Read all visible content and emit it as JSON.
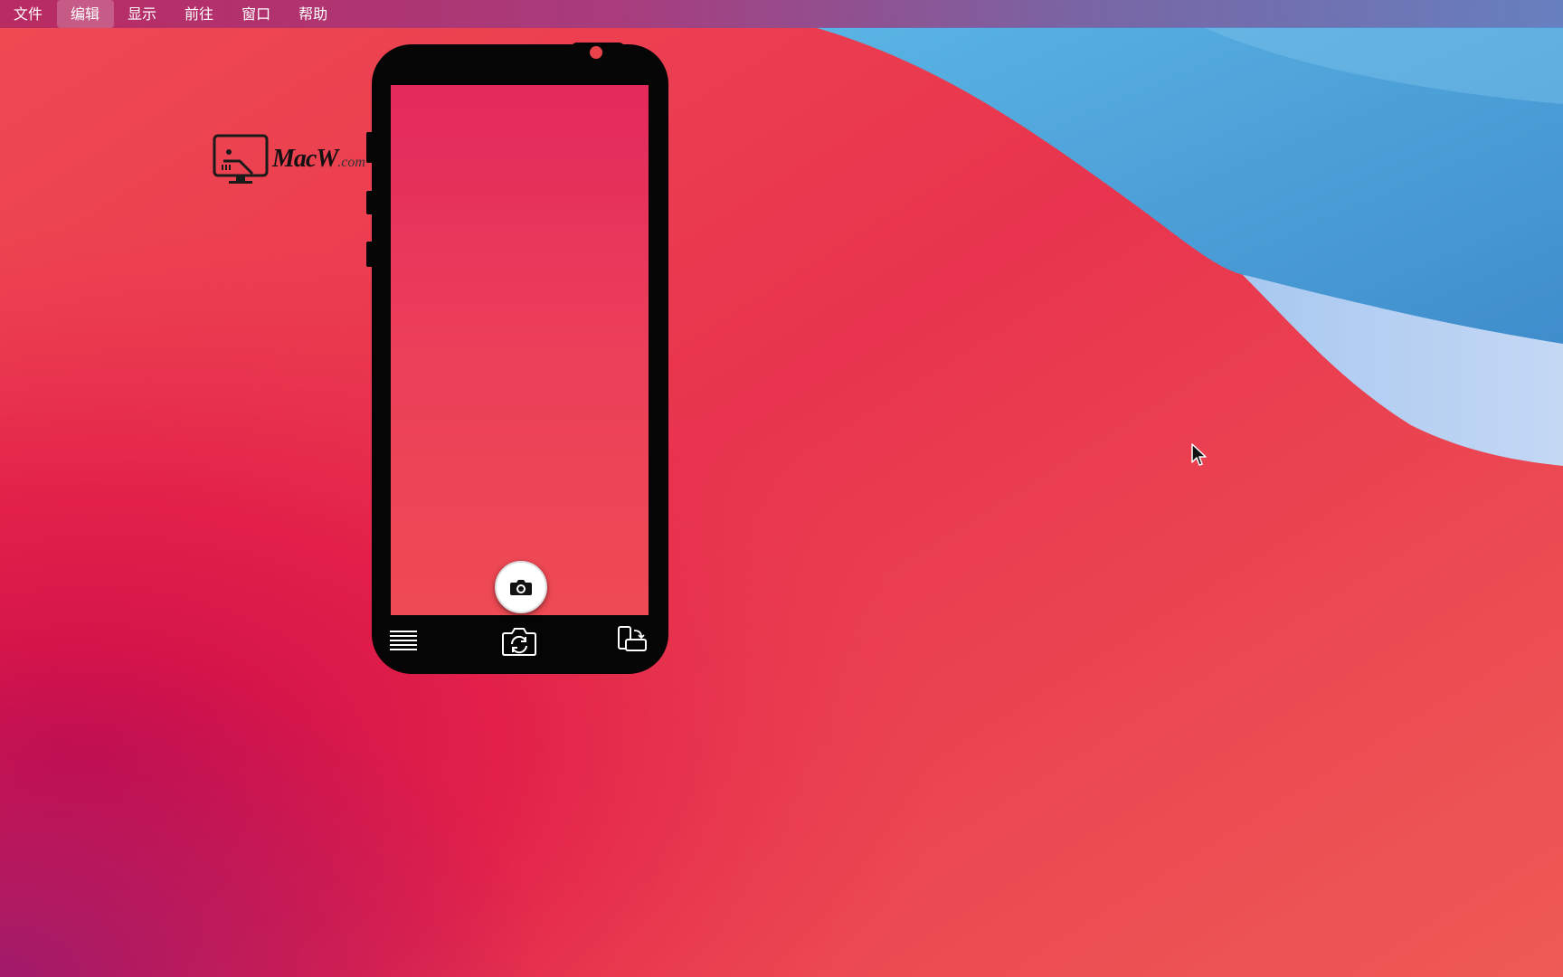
{
  "menubar": {
    "items": [
      {
        "label": "文件",
        "active": false
      },
      {
        "label": "编辑",
        "active": true
      },
      {
        "label": "显示",
        "active": false
      },
      {
        "label": "前往",
        "active": false
      },
      {
        "label": "窗口",
        "active": false
      },
      {
        "label": "帮助",
        "active": false
      }
    ]
  },
  "watermark": {
    "brand_main": "MacW",
    "brand_suffix": ".com"
  },
  "camera_app": {
    "camera_indicator_color": "#e8434a",
    "icons": {
      "shutter": "camera-icon",
      "menu": "hamburger-menu-icon",
      "switch_camera": "switch-camera-icon",
      "orientation": "rotate-device-icon"
    }
  },
  "colors": {
    "wallpaper_red": "#e8344e",
    "wallpaper_blue": "#4fa2d8",
    "phone_body": "#050505"
  }
}
